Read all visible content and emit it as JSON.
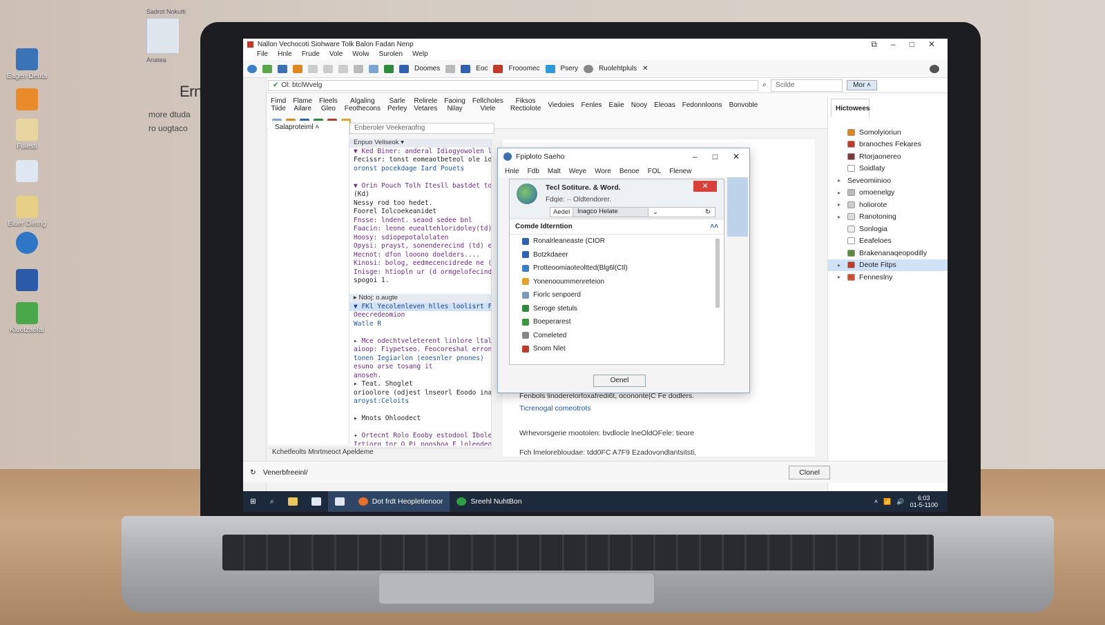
{
  "background": {
    "desktop_icons": [
      {
        "label": "Eagen Deuta",
        "color": "#3a74b7"
      },
      {
        "label": "",
        "color": "#e98a2b"
      },
      {
        "label": "Fulesti",
        "color": "#e8d6a0"
      },
      {
        "label": "",
        "color": "#dfe8f2"
      },
      {
        "label": "Eiuer Dietng",
        "color": "#e8cf86"
      },
      {
        "label": "",
        "color": "#2e77c7"
      },
      {
        "label": "",
        "color": "#2b5aa8"
      },
      {
        "label": "Kluotzaofai",
        "color": "#4aa84a"
      }
    ],
    "card_label": "Sadrot Nokutti",
    "card_sub": "Anatea",
    "title": "Ernnction",
    "sub_lines": [
      "more dtuda",
      "ro uogtaco"
    ]
  },
  "window": {
    "title": "Nallon Vechocoti   Siohware   Tolk Balon   Fadan   Nenp",
    "menu": [
      "File",
      "Hnle",
      "Frude",
      "Vole",
      "Wolw",
      "Surolen",
      "Welp"
    ],
    "toolbar_items": [
      "Doomes",
      "Eoc",
      "Frooomec",
      "Psery",
      "Ruolehtpluls"
    ],
    "address": "Ol: btclWvelg",
    "search_placeholder": "Scilde",
    "search_button": "Mor ˄",
    "ribbon_groups": [
      {
        "l1": "Fimd",
        "l2": "Tiide"
      },
      {
        "l1": "Flame",
        "l2": "Ailare"
      },
      {
        "l1": "Fleels",
        "l2": "Gleo"
      },
      {
        "l1": "Algaling",
        "l2": "Feothecons"
      },
      {
        "l1": "Sarle",
        "l2": "Perley"
      },
      {
        "l1": "Relirele",
        "l2": "Vetares"
      },
      {
        "l1": "Faoing",
        "l2": "Nilay"
      },
      {
        "l1": "Fellcholes",
        "l2": "Viele"
      },
      {
        "l1": "Fiksos",
        "l2": "Rectiolote"
      }
    ],
    "ribbon_right": [
      "Viedoies",
      "Fenles",
      "Eaiie",
      "Nooy",
      "Eleoas",
      "Fedonnloons",
      "Bonvoble"
    ],
    "left_pane_title": "Salaproteiml ˄",
    "filter_placeholder": "Enberoler Veekeraofng",
    "code_header": "Enpuo Veliseok ▾",
    "code_lines": [
      {
        "text": "▼ Ked Biner: anderal Idiogyowolen le?",
        "style": "purple"
      },
      {
        "text": "  Fecissr: tonst eomeaotbeteol ole ioletion",
        "style": ""
      },
      {
        "text": "  oronst pocekdage Iard Pouets",
        "style": "blue"
      },
      {
        "text": "",
        "style": ""
      },
      {
        "text": "▼ Orin Pouch Tolh Itesll bastdet toye(",
        "style": "purple"
      },
      {
        "text": "       (Kd)",
        "style": ""
      },
      {
        "text": "  Nessy rod too hedet.",
        "style": ""
      },
      {
        "text": "  Foorel Iolcoekeanidet",
        "style": ""
      },
      {
        "text": "  Fnsse: lndent. seaod sedee bnl",
        "style": "purple"
      },
      {
        "text": "  Faacin: leone euealtehloridoley(td)elevtol",
        "style": "purple"
      },
      {
        "text": "  Hoosy: sdiopepotalolaten",
        "style": "purple"
      },
      {
        "text": "  Opysi: prayst, sonenderecind (td) enol",
        "style": "purple"
      },
      {
        "text": "  Hecnot: dfon looono doelders....",
        "style": "purple"
      },
      {
        "text": "  Kinosi: bolog, eedmecencidrede ne ((e) ct",
        "style": "purple"
      },
      {
        "text": "  Inisge: htiopln ur (d ormgelofecindin",
        "style": "purple"
      },
      {
        "text": "  spogoi 1.",
        "style": ""
      },
      {
        "text": "",
        "style": ""
      },
      {
        "text": "▸ Ndoj: o.augte",
        "style": "head"
      },
      {
        "text": "▼ FKl Yecolenleven hlles loolisrt Finted",
        "style": "hl"
      },
      {
        "text": "  Oeecredeomion",
        "style": "purple"
      },
      {
        "text": "  Watle R",
        "style": "blue"
      },
      {
        "text": "",
        "style": ""
      },
      {
        "text": "▸ Mce odechtveleterent linlore ltalpoyotr",
        "style": "purple"
      },
      {
        "text": "  aioop: Fiypetseo. Feocoreshal erronhena",
        "style": "purple"
      },
      {
        "text": "  tonen Iegiarlon (eoesnler pnones)",
        "style": "blue"
      },
      {
        "text": "  esuno arse tosang it",
        "style": "purple"
      },
      {
        "text": "  anoseh.",
        "style": "purple"
      },
      {
        "text": "▸ Teat. Shoglet",
        "style": ""
      },
      {
        "text": "      orioolore (odjest lnseorl Eoodo inalio",
        "style": ""
      },
      {
        "text": "  aroyst:Celoits",
        "style": "blue"
      },
      {
        "text": "",
        "style": ""
      },
      {
        "text": "▸ Mnots Ohloodect",
        "style": ""
      },
      {
        "text": "",
        "style": ""
      },
      {
        "text": "✦ Ortecnt  Rolo Eooby estodool Iboleoel ailc",
        "style": "purple"
      },
      {
        "text": "  Irtiorg tor O Pi pooshoa F loleodeoument",
        "style": "purple"
      }
    ],
    "code_footer": "Kchetfeolts Mnrtmeoct Apeldeme",
    "doc_lines": [
      {
        "text": "Fenbols linoderelorfoxafredi6t, ocononte|C Fe dodlers.",
        "color": "#333"
      },
      {
        "text": "Ticrenogal comeotrots",
        "color": "#1d56b8"
      },
      {
        "text": "Wrhevorsgerie rnootolen: bvdlocle lneOldOFele: tieore",
        "color": "#333"
      },
      {
        "text": "Fch lmelorebloudae: tdd0FC A7F9 Ezadovondlantsitsti,",
        "color": "#333"
      }
    ],
    "right_panel": {
      "tab": "Hictowees",
      "items": [
        {
          "label": "Somolyioriun",
          "chev": "",
          "color": "#e0861c",
          "selected": false
        },
        {
          "label": "branoches Fekares",
          "chev": "",
          "color": "#c0392b",
          "selected": false
        },
        {
          "label": "Rtorjaonereo",
          "chev": "",
          "color": "#7a3a3a",
          "selected": false
        },
        {
          "label": "Soidlaty",
          "chev": "",
          "color": "#ffffff",
          "selected": false
        },
        {
          "label": "Seveomiinioo",
          "chev": "▸",
          "color": "",
          "selected": false
        },
        {
          "label": "omoenelgy",
          "chev": "▸",
          "color": "#bbbbbb",
          "selected": false
        },
        {
          "label": "holiorote",
          "chev": "▸",
          "color": "#cccccc",
          "selected": false
        },
        {
          "label": "Ranotoning",
          "chev": "▸",
          "color": "#dddddd",
          "selected": false
        },
        {
          "label": "Sonlogia",
          "chev": "",
          "color": "#eeeeee",
          "selected": false
        },
        {
          "label": "Eeafeloes",
          "chev": "",
          "color": "#ffffff",
          "selected": false
        },
        {
          "label": "Brakenanaqeopodilly",
          "chev": "",
          "color": "#5c8a3c",
          "selected": false
        },
        {
          "label": "Deote Fitps",
          "chev": "▸",
          "color": "#c0392b",
          "selected": true
        },
        {
          "label": "Fenneslny",
          "chev": "▸",
          "color": "#d14e2b",
          "selected": false
        }
      ]
    },
    "bottom": {
      "status": "Venerbfreeinl/",
      "close_button": "Clonel"
    },
    "taskbar": {
      "items": [
        {
          "label": "Dot frdt Heopletienoor",
          "active": true,
          "color": "#e76f2b"
        },
        {
          "label": "Sreehl NuhtBon",
          "active": false,
          "color": "#2ea043"
        }
      ],
      "time": "6:03",
      "date": "01-5-1100"
    }
  },
  "dialog": {
    "title": "Fpiploto Saeho",
    "menu": [
      "Hnle",
      "Fdb",
      "Malt",
      "Weye",
      "Wore",
      "Benoe",
      "FOL",
      "Flenew"
    ],
    "inner_title": "Tecl Sotiture. & Word.",
    "inner_sub": "Fdqie: ·· Oldtendorer.",
    "field_label": "Aedel",
    "field_value": "Inagco Helate",
    "group_title": "Comde Idterntion",
    "options": [
      {
        "label": "Ronalrleaneaste (CIOR",
        "color": "#2f62b3"
      },
      {
        "label": "Botzkdaeer",
        "color": "#2f62b3"
      },
      {
        "label": "Protteoomiaoteoltted(Blg6l(CIl)",
        "color": "#3a7fc8"
      },
      {
        "label": "Yonenooummenreteion",
        "color": "#e0a42b"
      },
      {
        "label": "Fiorlc senpoerd",
        "color": "#7a9ab8"
      },
      {
        "label": "Seroge stetuls",
        "color": "#2e8b3c"
      },
      {
        "label": "Boeperarest",
        "color": "#3a9a3a"
      },
      {
        "label": "Comeleted",
        "color": "#888888"
      },
      {
        "label": "Snom Nlet",
        "color": "#c0392b"
      }
    ],
    "cancel_button": "Oenel"
  }
}
